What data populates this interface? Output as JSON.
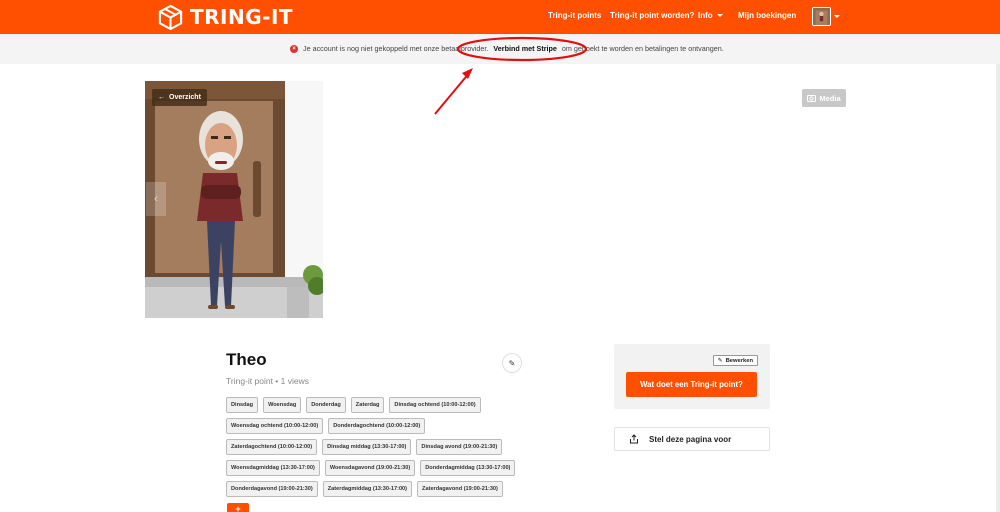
{
  "header": {
    "brand": "TRING-IT",
    "nav": [
      {
        "label": "Tring-it points"
      },
      {
        "label": "Tring-it point worden?"
      },
      {
        "label": "Info"
      },
      {
        "label": "Mijn boekingen"
      }
    ],
    "colors": {
      "accent": "#fe5000"
    }
  },
  "notice": {
    "text_before": "Je account is nog niet gekoppeld met onze betaalprovider.",
    "link": "Verbind met Stripe",
    "text_after": "om geboekt te worden en betalingen te ontvangen."
  },
  "hero": {
    "overview_label": "Overzicht",
    "media_label": "Media"
  },
  "profile": {
    "name": "Theo",
    "subtitle": "Tring-it point • 1 views",
    "tag_rows": [
      [
        "Dinsdag",
        "Woensdag",
        "Donderdag",
        "Zaterdag",
        "Dinsdag ochtend (10:00-12:00)"
      ],
      [
        "Woensdag ochtend (10:00-12:00)",
        "Donderdagochtend (10:00-12:00)"
      ],
      [
        "Zaterdagochtend (10:00-12:00)",
        "Dinsdag middag (13:30-17:00)",
        "Dinsdag avond (19:00-21:30)"
      ],
      [
        "Woensdagmiddag (13:30-17:00)",
        "Woensdagavond (19:00-21:30)",
        "Donderdagmiddag (13:30-17:00)"
      ],
      [
        "Donderdagavond (19:00-21:30)",
        "Zaterdagmiddag (13:30-17:00)",
        "Zaterdagavond (19:00-21:30)"
      ]
    ],
    "add_label": "+"
  },
  "sidebar_card": {
    "edit_label": "Bewerken",
    "cta_label": "Wat doet een Tring-it point?",
    "suggest_label": "Stel deze pagina voor"
  }
}
